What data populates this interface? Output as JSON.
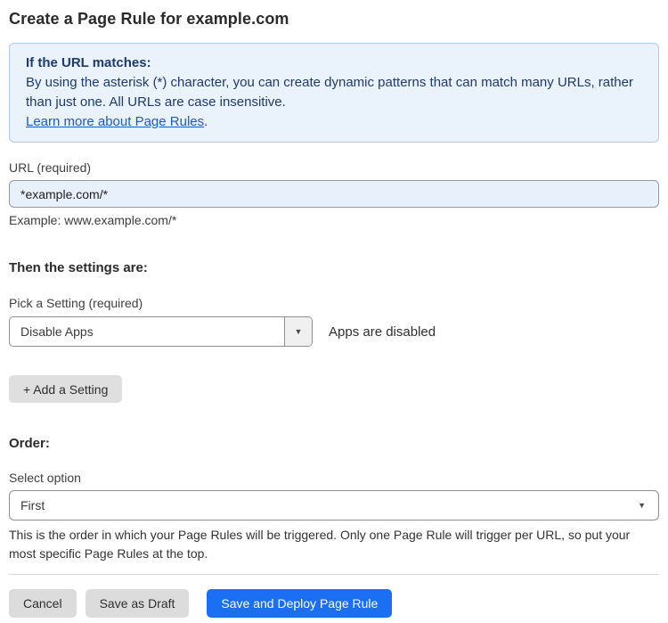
{
  "page": {
    "title": "Create a Page Rule for example.com"
  },
  "info_box": {
    "heading": "If the URL matches:",
    "body": "By using the asterisk (*) character, you can create dynamic patterns that can match many URLs, rather than just one. All URLs are case insensitive.",
    "link": "Learn more about Page Rules",
    "link_suffix": "."
  },
  "url_field": {
    "label": "URL (required)",
    "value": "*example.com/*",
    "helper": "Example: www.example.com/*"
  },
  "settings_section": {
    "heading": "Then the settings are:",
    "picker_label": "Pick a Setting (required)",
    "picker_value": "Disable Apps",
    "status_text": "Apps are disabled",
    "add_button": "+ Add a Setting"
  },
  "order_section": {
    "heading": "Order:",
    "select_label": "Select option",
    "select_value": "First",
    "helper": "This is the order in which your Page Rules will be triggered. Only one Page Rule will trigger per URL, so put your most specific Page Rules at the top."
  },
  "icons": {
    "caret_down": "▼"
  },
  "footer": {
    "cancel_label": "Cancel",
    "save_draft_label": "Save as Draft",
    "save_deploy_label": "Save and Deploy Page Rule"
  },
  "colors": {
    "primary_blue": "#1a6ff2",
    "info_bg": "#eaf2fc",
    "info_border": "#aecbef",
    "info_text": "#1e3a6e",
    "link_blue": "#2458c5",
    "input_bg": "#e8f0fb",
    "button_gray": "#dcdcdc"
  }
}
